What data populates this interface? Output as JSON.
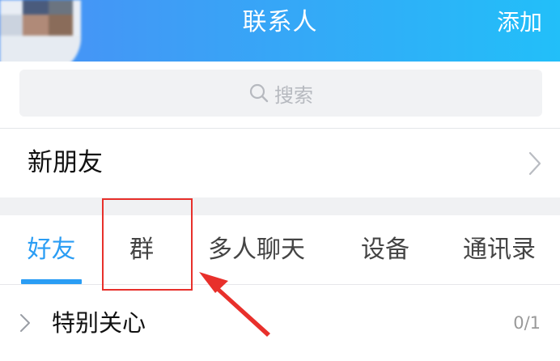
{
  "header": {
    "title": "联系人",
    "add_label": "添加"
  },
  "search": {
    "placeholder": "搜索"
  },
  "new_friends": {
    "label": "新朋友"
  },
  "tabs": [
    {
      "label": "好友",
      "active": true
    },
    {
      "label": "群",
      "active": false
    },
    {
      "label": "多人聊天",
      "active": false
    },
    {
      "label": "设备",
      "active": false
    },
    {
      "label": "通讯录",
      "active": false
    }
  ],
  "groups": [
    {
      "label": "特别关心",
      "count": "0/1"
    }
  ],
  "colors": {
    "header_gradient": [
      "#4a8ff5",
      "#22bff9"
    ],
    "accent": "#2a9df4",
    "annotation": "#e8302b"
  },
  "icons": {
    "search": "search-icon",
    "chevron_right": "chevron-right-icon",
    "chevron_small": "chevron-right-icon"
  }
}
